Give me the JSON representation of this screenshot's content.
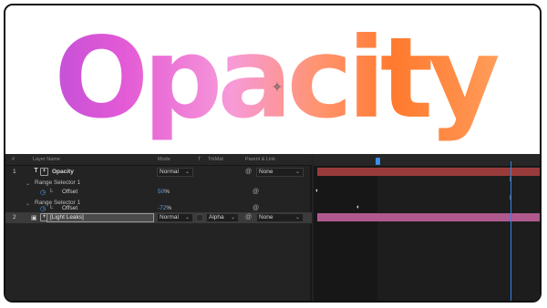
{
  "viewer": {
    "title_text": "Opacity",
    "gradient_colors": [
      "#b04ad8",
      "#e35ad6",
      "#f79ad8",
      "#ff9470",
      "#ff7a2e",
      "#ffb06f"
    ]
  },
  "timeline": {
    "columns": {
      "num": "#",
      "layer_name": "Layer Name",
      "mode": "Mode",
      "t": "T",
      "trkmat": "TrkMat",
      "parent": "Parent & Link"
    },
    "layers": [
      {
        "num": "1",
        "type_icon": "T",
        "name": "Opacity",
        "mode": "Normal",
        "parent": "None",
        "bar_color": "#9a3b3b"
      },
      {
        "num": "2",
        "name": "[Light Leaks]",
        "mode": "Normal",
        "trkmat": "Alpha",
        "parent": "None",
        "bar_color": "#b0598f"
      }
    ],
    "range_selectors": [
      {
        "label": "Range Selector 1",
        "property": "Offset",
        "value": "50",
        "unit": "%"
      },
      {
        "label": "Range Selector 1",
        "property": "Offset",
        "value": "-72",
        "unit": "%"
      }
    ],
    "accent_color": "#2f86e8"
  }
}
